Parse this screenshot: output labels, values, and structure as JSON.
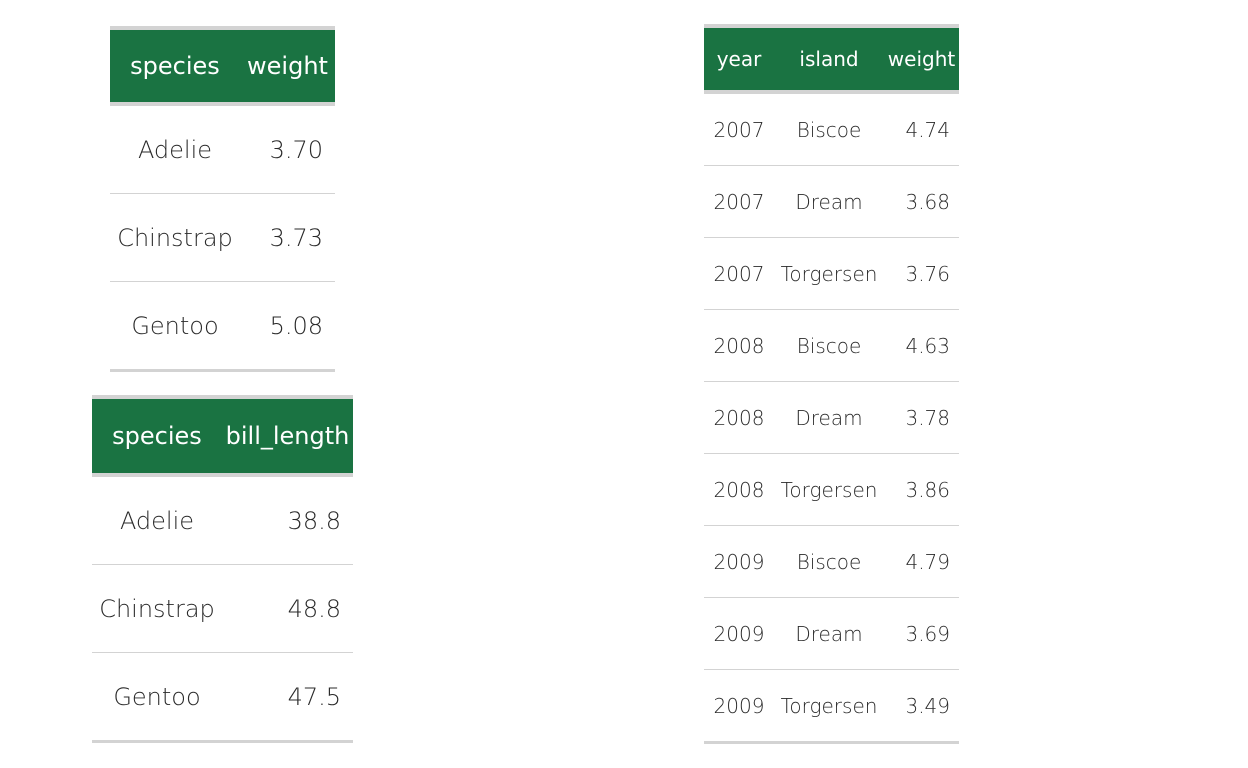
{
  "colors": {
    "header_bg": "#1a7342",
    "header_text": "#ffffff",
    "rule": "#d3d3d3"
  },
  "table_species_weight": {
    "headers": [
      "species",
      "weight"
    ],
    "rows": [
      [
        "Adelie",
        "3.70"
      ],
      [
        "Chinstrap",
        "3.73"
      ],
      [
        "Gentoo",
        "5.08"
      ]
    ]
  },
  "table_species_bill": {
    "headers": [
      "species",
      "bill_length"
    ],
    "rows": [
      [
        "Adelie",
        "38.8"
      ],
      [
        "Chinstrap",
        "48.8"
      ],
      [
        "Gentoo",
        "47.5"
      ]
    ]
  },
  "table_year_island": {
    "headers": [
      "year",
      "island",
      "weight"
    ],
    "rows": [
      [
        "2007",
        "Biscoe",
        "4.74"
      ],
      [
        "2007",
        "Dream",
        "3.68"
      ],
      [
        "2007",
        "Torgersen",
        "3.76"
      ],
      [
        "2008",
        "Biscoe",
        "4.63"
      ],
      [
        "2008",
        "Dream",
        "3.78"
      ],
      [
        "2008",
        "Torgersen",
        "3.86"
      ],
      [
        "2009",
        "Biscoe",
        "4.79"
      ],
      [
        "2009",
        "Dream",
        "3.69"
      ],
      [
        "2009",
        "Torgersen",
        "3.49"
      ]
    ]
  }
}
